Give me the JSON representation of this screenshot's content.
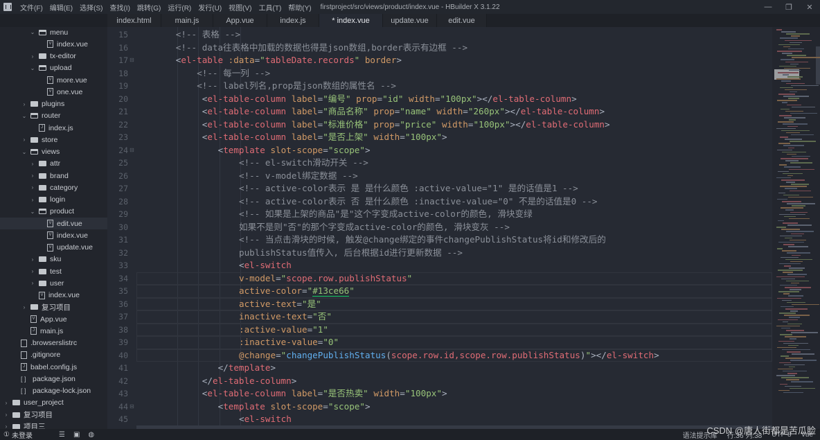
{
  "titlebar": {
    "menus": [
      "文件(F)",
      "编辑(E)",
      "选择(S)",
      "查找(I)",
      "跳转(G)",
      "运行(R)",
      "发行(U)",
      "视图(V)",
      "工具(T)",
      "帮助(Y)"
    ],
    "window_title": "firstproject/src/views/product/index.vue - HBuilder X 3.1.22",
    "minimize": "—",
    "maximize": "❐",
    "close": "✕"
  },
  "tabs": [
    {
      "label": "index.html",
      "active": false
    },
    {
      "label": "main.js",
      "active": false
    },
    {
      "label": "App.vue",
      "active": false
    },
    {
      "label": "index.js",
      "active": false
    },
    {
      "label": "* index.vue",
      "active": true
    },
    {
      "label": "update.vue",
      "active": false
    },
    {
      "label": "edit.vue",
      "active": false
    }
  ],
  "sidebar": {
    "items": [
      {
        "label": "menu",
        "type": "folder-open",
        "depth": 3
      },
      {
        "label": "index.vue",
        "type": "vue",
        "depth": 4
      },
      {
        "label": "tx-editor",
        "type": "folder",
        "depth": 3
      },
      {
        "label": "upload",
        "type": "folder-open",
        "depth": 3
      },
      {
        "label": "more.vue",
        "type": "vue",
        "depth": 4
      },
      {
        "label": "one.vue",
        "type": "vue",
        "depth": 4
      },
      {
        "label": "plugins",
        "type": "folder",
        "depth": 2
      },
      {
        "label": "router",
        "type": "folder-open",
        "depth": 2
      },
      {
        "label": "index.js",
        "type": "js",
        "depth": 3
      },
      {
        "label": "store",
        "type": "folder",
        "depth": 2
      },
      {
        "label": "views",
        "type": "folder-open",
        "depth": 2
      },
      {
        "label": "attr",
        "type": "folder",
        "depth": 3
      },
      {
        "label": "brand",
        "type": "folder",
        "depth": 3
      },
      {
        "label": "category",
        "type": "folder",
        "depth": 3
      },
      {
        "label": "login",
        "type": "folder",
        "depth": 3
      },
      {
        "label": "product",
        "type": "folder-open",
        "depth": 3
      },
      {
        "label": "edit.vue",
        "type": "vue",
        "depth": 4,
        "selected": true
      },
      {
        "label": "index.vue",
        "type": "vue",
        "depth": 4
      },
      {
        "label": "update.vue",
        "type": "vue",
        "depth": 4
      },
      {
        "label": "sku",
        "type": "folder",
        "depth": 3
      },
      {
        "label": "test",
        "type": "folder",
        "depth": 3
      },
      {
        "label": "user",
        "type": "folder",
        "depth": 3
      },
      {
        "label": "index.vue",
        "type": "vue",
        "depth": 3
      },
      {
        "label": "复习项目",
        "type": "folder",
        "depth": 2
      },
      {
        "label": "App.vue",
        "type": "vue",
        "depth": 2
      },
      {
        "label": "main.js",
        "type": "js",
        "depth": 2
      },
      {
        "label": ".browserslistrc",
        "type": "file",
        "depth": 1
      },
      {
        "label": ".gitignore",
        "type": "file",
        "depth": 1
      },
      {
        "label": "babel.config.js",
        "type": "js",
        "depth": 1
      },
      {
        "label": "package.json",
        "type": "json",
        "depth": 1
      },
      {
        "label": "package-lock.json",
        "type": "json",
        "depth": 1
      },
      {
        "label": "user_project",
        "type": "project",
        "depth": 0
      },
      {
        "label": "复习项目",
        "type": "project",
        "depth": 0
      },
      {
        "label": "项目三",
        "type": "project",
        "depth": 0
      }
    ],
    "login_status": "未登录"
  },
  "editor": {
    "lines": [
      {
        "n": 15,
        "fold": false,
        "indent": 8,
        "tokens": [
          [
            "cm",
            "<!-- 表格 -->"
          ]
        ]
      },
      {
        "n": 16,
        "fold": false,
        "indent": 8,
        "tokens": [
          [
            "cm",
            "<!-- data往表格中加载的数据也得是json数组,border表示有边框 -->"
          ]
        ]
      },
      {
        "n": 17,
        "fold": true,
        "indent": 8,
        "tokens": [
          [
            "pu",
            "<"
          ],
          [
            "tg",
            "el-table"
          ],
          [
            "at",
            " :data"
          ],
          [
            "pu",
            "="
          ],
          [
            "st",
            "\""
          ],
          [
            "sr",
            "tableDate.records"
          ],
          [
            "st",
            "\""
          ],
          [
            "at",
            " border"
          ],
          [
            "pu",
            ">"
          ]
        ]
      },
      {
        "n": 18,
        "fold": false,
        "indent": 12,
        "tokens": [
          [
            "cm",
            "<!-- 每一列 -->"
          ]
        ]
      },
      {
        "n": 19,
        "fold": false,
        "indent": 12,
        "tokens": [
          [
            "cm",
            "<!-- label列名,prop是json数组的属性名 -->"
          ]
        ]
      },
      {
        "n": 20,
        "fold": false,
        "indent": 13,
        "tokens": [
          [
            "pu",
            "<"
          ],
          [
            "tg",
            "el-table-column"
          ],
          [
            "at",
            " label"
          ],
          [
            "pu",
            "="
          ],
          [
            "st",
            "\"编号\""
          ],
          [
            "at",
            " prop"
          ],
          [
            "pu",
            "="
          ],
          [
            "st",
            "\"id\""
          ],
          [
            "at",
            " width"
          ],
          [
            "pu",
            "="
          ],
          [
            "st",
            "\"100px\""
          ],
          [
            "pu",
            "></"
          ],
          [
            "tg",
            "el-table-column"
          ],
          [
            "pu",
            ">"
          ]
        ]
      },
      {
        "n": 21,
        "fold": false,
        "indent": 13,
        "tokens": [
          [
            "pu",
            "<"
          ],
          [
            "tg",
            "el-table-column"
          ],
          [
            "at",
            " label"
          ],
          [
            "pu",
            "="
          ],
          [
            "st",
            "\"商品名称\""
          ],
          [
            "at",
            " prop"
          ],
          [
            "pu",
            "="
          ],
          [
            "st",
            "\"name\""
          ],
          [
            "at",
            " width"
          ],
          [
            "pu",
            "="
          ],
          [
            "st",
            "\"260px\""
          ],
          [
            "pu",
            "></"
          ],
          [
            "tg",
            "el-table-column"
          ],
          [
            "pu",
            ">"
          ]
        ]
      },
      {
        "n": 22,
        "fold": false,
        "indent": 13,
        "tokens": [
          [
            "pu",
            "<"
          ],
          [
            "tg",
            "el-table-column"
          ],
          [
            "at",
            " label"
          ],
          [
            "pu",
            "="
          ],
          [
            "st",
            "\"标准价格\""
          ],
          [
            "at",
            " prop"
          ],
          [
            "pu",
            "="
          ],
          [
            "st",
            "\"price\""
          ],
          [
            "at",
            " width"
          ],
          [
            "pu",
            "="
          ],
          [
            "st",
            "\"100px\""
          ],
          [
            "pu",
            "></"
          ],
          [
            "tg",
            "el-table-column"
          ],
          [
            "pu",
            ">"
          ]
        ]
      },
      {
        "n": 23,
        "fold": false,
        "indent": 13,
        "tokens": [
          [
            "pu",
            "<"
          ],
          [
            "tg",
            "el-table-column"
          ],
          [
            "at",
            " label"
          ],
          [
            "pu",
            "="
          ],
          [
            "st",
            "\"是否上架\""
          ],
          [
            "at",
            " width"
          ],
          [
            "pu",
            "="
          ],
          [
            "st",
            "\"100px\""
          ],
          [
            "pu",
            ">"
          ]
        ]
      },
      {
        "n": 24,
        "fold": true,
        "indent": 16,
        "tokens": [
          [
            "pu",
            "<"
          ],
          [
            "tg",
            "template"
          ],
          [
            "at",
            " slot-scope"
          ],
          [
            "pu",
            "="
          ],
          [
            "st",
            "\"scope\""
          ],
          [
            "pu",
            ">"
          ]
        ]
      },
      {
        "n": 25,
        "fold": false,
        "indent": 20,
        "tokens": [
          [
            "cm",
            "<!-- el-switch滑动开关 -->"
          ]
        ]
      },
      {
        "n": 26,
        "fold": false,
        "indent": 20,
        "tokens": [
          [
            "cm",
            "<!-- v-model绑定数据 -->"
          ]
        ]
      },
      {
        "n": 27,
        "fold": false,
        "indent": 20,
        "tokens": [
          [
            "cm",
            "<!-- active-color表示 是 是什么颜色 :active-value=\"1\" 是的话值是1 -->"
          ]
        ]
      },
      {
        "n": 28,
        "fold": false,
        "indent": 20,
        "tokens": [
          [
            "cm",
            "<!-- active-color表示 否 是什么颜色 :inactive-value=\"0\" 不是的话值是0 -->"
          ]
        ]
      },
      {
        "n": 29,
        "fold": false,
        "indent": 20,
        "tokens": [
          [
            "cm",
            "<!-- 如果是上架的商品\"是\"这个字变成active-color的颜色, 滑块变绿"
          ]
        ]
      },
      {
        "n": 30,
        "fold": false,
        "indent": 20,
        "tokens": [
          [
            "cm",
            "如果不是则\"否\"的那个字变成active-color的颜色, 滑块变灰 -->"
          ]
        ]
      },
      {
        "n": 31,
        "fold": false,
        "indent": 20,
        "tokens": [
          [
            "cm",
            "<!-- 当点击滑块的时候, 触发@change绑定的事件changePublishStatus将id和修改后的"
          ]
        ]
      },
      {
        "n": 32,
        "fold": false,
        "indent": 20,
        "tokens": [
          [
            "cm",
            "publishStatus值传入, 后台根据id进行更新数据 -->"
          ]
        ]
      },
      {
        "n": 33,
        "fold": false,
        "indent": 20,
        "tokens": [
          [
            "pu",
            "<"
          ],
          [
            "tg",
            "el-switch"
          ]
        ]
      },
      {
        "n": 34,
        "fold": false,
        "indent": 20,
        "tokens": [
          [
            "at",
            "v-model"
          ],
          [
            "pu",
            "="
          ],
          [
            "st",
            "\""
          ],
          [
            "sr",
            "scope.row.publishStatus"
          ],
          [
            "st",
            "\""
          ]
        ]
      },
      {
        "n": 35,
        "fold": false,
        "indent": 20,
        "tokens": [
          [
            "at",
            "active-color"
          ],
          [
            "pu",
            "="
          ],
          [
            "st",
            "\""
          ],
          [
            "ul",
            "#13ce66"
          ],
          [
            "st",
            "\""
          ]
        ]
      },
      {
        "n": 36,
        "fold": false,
        "indent": 20,
        "tokens": [
          [
            "at",
            "active-text"
          ],
          [
            "pu",
            "="
          ],
          [
            "st",
            "\"是\""
          ]
        ]
      },
      {
        "n": 37,
        "fold": false,
        "indent": 20,
        "tokens": [
          [
            "at",
            "inactive-text"
          ],
          [
            "pu",
            "="
          ],
          [
            "st",
            "\"否\""
          ]
        ]
      },
      {
        "n": 38,
        "fold": false,
        "indent": 20,
        "tokens": [
          [
            "at",
            ":active-value"
          ],
          [
            "pu",
            "="
          ],
          [
            "st",
            "\"1\""
          ]
        ]
      },
      {
        "n": 39,
        "fold": false,
        "indent": 20,
        "tokens": [
          [
            "at",
            ":inactive-value"
          ],
          [
            "pu",
            "="
          ],
          [
            "st",
            "\"0\""
          ]
        ]
      },
      {
        "n": 40,
        "fold": false,
        "indent": 20,
        "tokens": [
          [
            "at",
            "@change"
          ],
          [
            "pu",
            "="
          ],
          [
            "st",
            "\""
          ],
          [
            "fn",
            "changePublishStatus"
          ],
          [
            "pu",
            "("
          ],
          [
            "sr",
            "scope.row.id,scope.row.publishStatus"
          ],
          [
            "pu",
            ")"
          ],
          [
            "st",
            "\""
          ],
          [
            "pu",
            "></"
          ],
          [
            "tg",
            "el-switch"
          ],
          [
            "pu",
            ">"
          ]
        ]
      },
      {
        "n": 41,
        "fold": false,
        "indent": 16,
        "tokens": [
          [
            "pu",
            "</"
          ],
          [
            "tg",
            "template"
          ],
          [
            "pu",
            ">"
          ]
        ]
      },
      {
        "n": 42,
        "fold": false,
        "indent": 13,
        "tokens": [
          [
            "pu",
            "</"
          ],
          [
            "tg",
            "el-table-column"
          ],
          [
            "pu",
            ">"
          ]
        ]
      },
      {
        "n": 43,
        "fold": false,
        "indent": 13,
        "tokens": [
          [
            "pu",
            "<"
          ],
          [
            "tg",
            "el-table-column"
          ],
          [
            "at",
            " label"
          ],
          [
            "pu",
            "="
          ],
          [
            "st",
            "\"是否热卖\""
          ],
          [
            "at",
            " width"
          ],
          [
            "pu",
            "="
          ],
          [
            "st",
            "\"100px\""
          ],
          [
            "pu",
            ">"
          ]
        ]
      },
      {
        "n": 44,
        "fold": true,
        "indent": 16,
        "tokens": [
          [
            "pu",
            "<"
          ],
          [
            "tg",
            "template"
          ],
          [
            "at",
            " slot-scope"
          ],
          [
            "pu",
            "="
          ],
          [
            "st",
            "\"scope\""
          ],
          [
            "pu",
            ">"
          ]
        ]
      },
      {
        "n": 45,
        "fold": false,
        "indent": 20,
        "tokens": [
          [
            "pu",
            "<"
          ],
          [
            "tg",
            "el-switch"
          ]
        ]
      }
    ],
    "highlighted_lines": [
      34,
      35,
      36,
      37,
      38,
      39,
      40
    ]
  },
  "statusbar": {
    "syntax_lib": "语法提示库",
    "position": "行:36  列:38",
    "encoding": "UTF-8",
    "language": "Vue"
  },
  "watermark": "CSDN @唐人街都是苦瓜脸"
}
